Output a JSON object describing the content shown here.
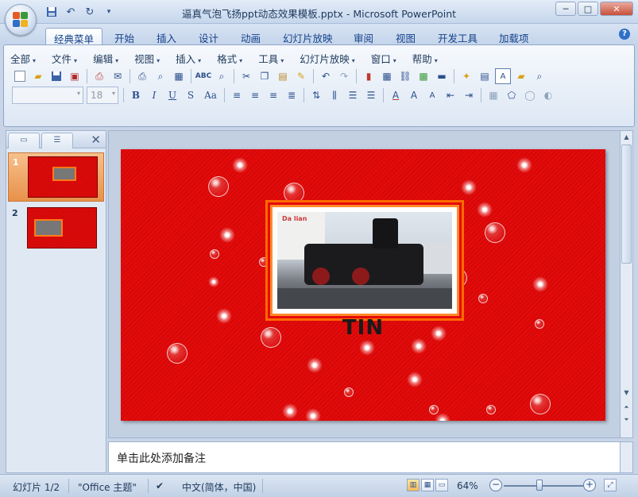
{
  "window": {
    "title": "逼真气泡飞扬ppt动态效果模板.pptx - Microsoft PowerPoint",
    "controls": {
      "minimize": "─",
      "maximize": "□",
      "close": "✕"
    }
  },
  "quick_access": {
    "save_icon": "save-icon",
    "undo_icon": "undo-icon",
    "redo_icon": "redo-icon",
    "customize_icon": "chevron-down-icon"
  },
  "ribbon_tabs": [
    {
      "label": "经典菜单",
      "active": true
    },
    {
      "label": "开始"
    },
    {
      "label": "插入"
    },
    {
      "label": "设计"
    },
    {
      "label": "动画"
    },
    {
      "label": "幻灯片放映"
    },
    {
      "label": "审阅"
    },
    {
      "label": "视图"
    },
    {
      "label": "开发工具"
    },
    {
      "label": "加载项"
    }
  ],
  "classic_menu": [
    {
      "label": "全部"
    },
    {
      "label": "文件"
    },
    {
      "label": "编辑"
    },
    {
      "label": "视图"
    },
    {
      "label": "插入"
    },
    {
      "label": "格式"
    },
    {
      "label": "工具"
    },
    {
      "label": "幻灯片放映"
    },
    {
      "label": "窗口"
    },
    {
      "label": "帮助"
    }
  ],
  "format_toolbar": {
    "font_name": "",
    "font_size": "18",
    "bold": "B",
    "italic": "I",
    "underline": "U",
    "shadow": "S",
    "change_case": "Aa"
  },
  "slides_pane": {
    "tab_slides_icon": "slides-tab-icon",
    "tab_outline_icon": "outline-tab-icon",
    "close_icon": "close-icon",
    "thumbnails": [
      {
        "number": "1",
        "selected": true
      },
      {
        "number": "2",
        "selected": false
      }
    ]
  },
  "slide": {
    "title": "TIN",
    "photo_logo": "Da lian",
    "background_color": "#e50a0a",
    "frame_color": "#ff8a2a"
  },
  "notes": {
    "placeholder": "单击此处添加备注"
  },
  "status_bar": {
    "slide_position": "幻灯片 1/2",
    "theme": "\"Office 主题\"",
    "language": "中文(简体，中国)",
    "zoom_level": "64%",
    "zoom_fraction": 0.45
  },
  "colors": {
    "accent": "#15428b",
    "ribbon_bg": "#dde7f4",
    "selection": "#e8914a"
  }
}
